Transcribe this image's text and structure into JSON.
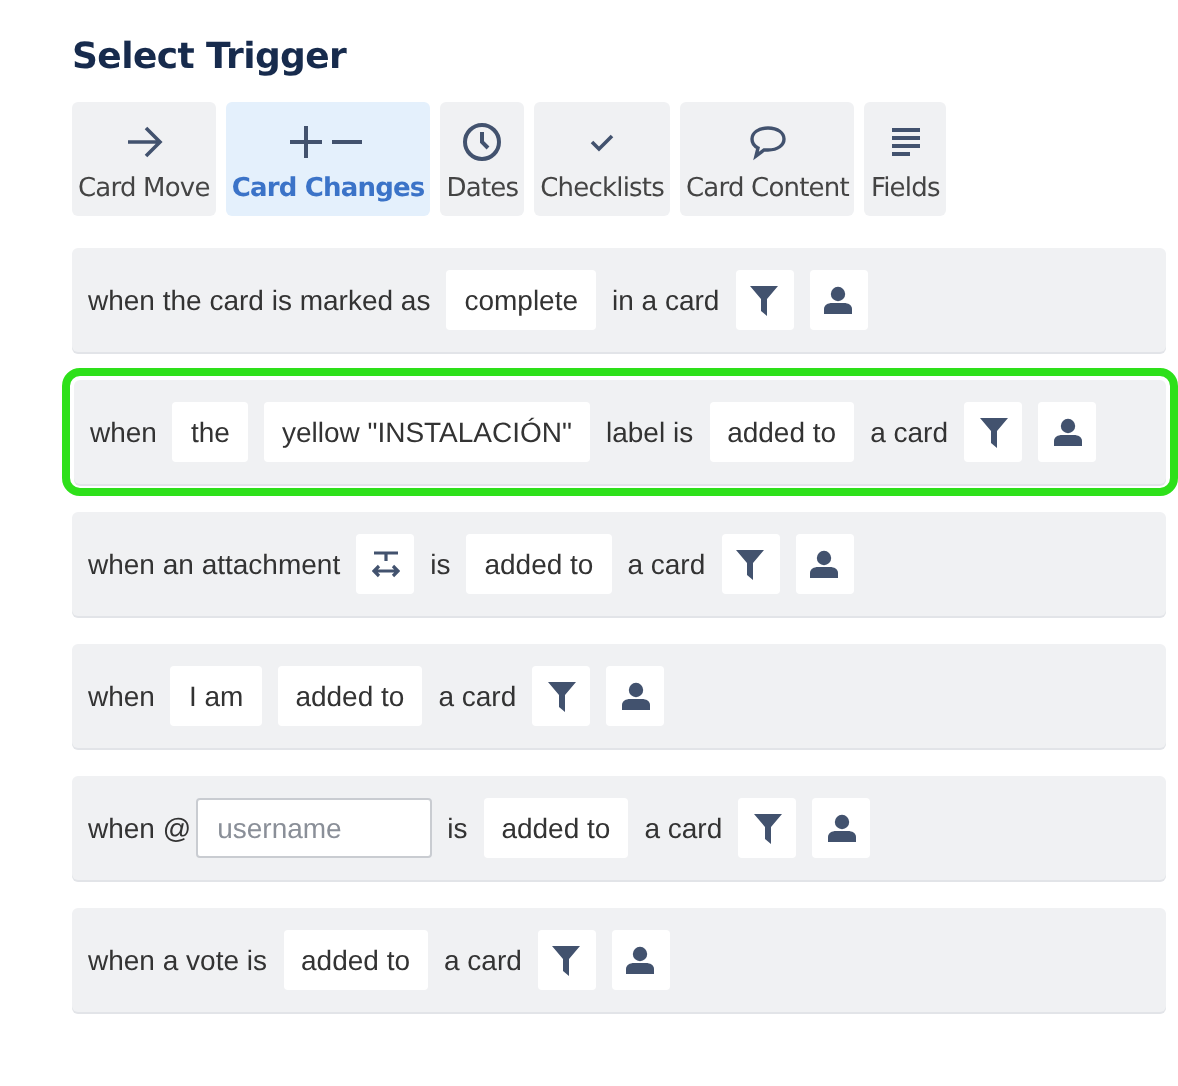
{
  "title": "Select Trigger",
  "tabs": [
    {
      "label": "Card Move",
      "selected": false
    },
    {
      "label": "Card Changes",
      "selected": true
    },
    {
      "label": "Dates",
      "selected": false
    },
    {
      "label": "Checklists",
      "selected": false
    },
    {
      "label": "Card Content",
      "selected": false
    },
    {
      "label": "Fields",
      "selected": false
    }
  ],
  "triggers": [
    {
      "highlighted": false,
      "parts": [
        {
          "kind": "text",
          "text": "when the card is marked as"
        },
        {
          "kind": "option",
          "text": "complete"
        },
        {
          "kind": "text",
          "text": "in a card"
        },
        {
          "kind": "filter"
        },
        {
          "kind": "member"
        }
      ]
    },
    {
      "highlighted": true,
      "parts": [
        {
          "kind": "text",
          "text": "when"
        },
        {
          "kind": "option",
          "text": "the"
        },
        {
          "kind": "option",
          "text": "yellow \"INSTALACIÓN\""
        },
        {
          "kind": "text",
          "text": "label is"
        },
        {
          "kind": "option",
          "text": "added to"
        },
        {
          "kind": "text",
          "text": "a card"
        },
        {
          "kind": "filter"
        },
        {
          "kind": "member"
        }
      ]
    },
    {
      "highlighted": false,
      "parts": [
        {
          "kind": "text",
          "text": "when an attachment"
        },
        {
          "kind": "attachment"
        },
        {
          "kind": "text",
          "text": "is"
        },
        {
          "kind": "option",
          "text": "added to"
        },
        {
          "kind": "text",
          "text": "a card"
        },
        {
          "kind": "filter"
        },
        {
          "kind": "member"
        }
      ]
    },
    {
      "highlighted": false,
      "parts": [
        {
          "kind": "text",
          "text": "when"
        },
        {
          "kind": "option",
          "text": "I am"
        },
        {
          "kind": "option",
          "text": "added to"
        },
        {
          "kind": "text",
          "text": "a card"
        },
        {
          "kind": "filter"
        },
        {
          "kind": "member"
        }
      ]
    },
    {
      "highlighted": false,
      "parts": [
        {
          "kind": "text",
          "text": "when @"
        },
        {
          "kind": "input",
          "placeholder": "username"
        },
        {
          "kind": "text",
          "text": "is"
        },
        {
          "kind": "option",
          "text": "added to"
        },
        {
          "kind": "text",
          "text": "a card"
        },
        {
          "kind": "filter"
        },
        {
          "kind": "member"
        }
      ]
    },
    {
      "highlighted": false,
      "parts": [
        {
          "kind": "text",
          "text": "when a vote is"
        },
        {
          "kind": "option",
          "text": "added to"
        },
        {
          "kind": "text",
          "text": "a card"
        },
        {
          "kind": "filter"
        },
        {
          "kind": "member"
        }
      ]
    }
  ]
}
